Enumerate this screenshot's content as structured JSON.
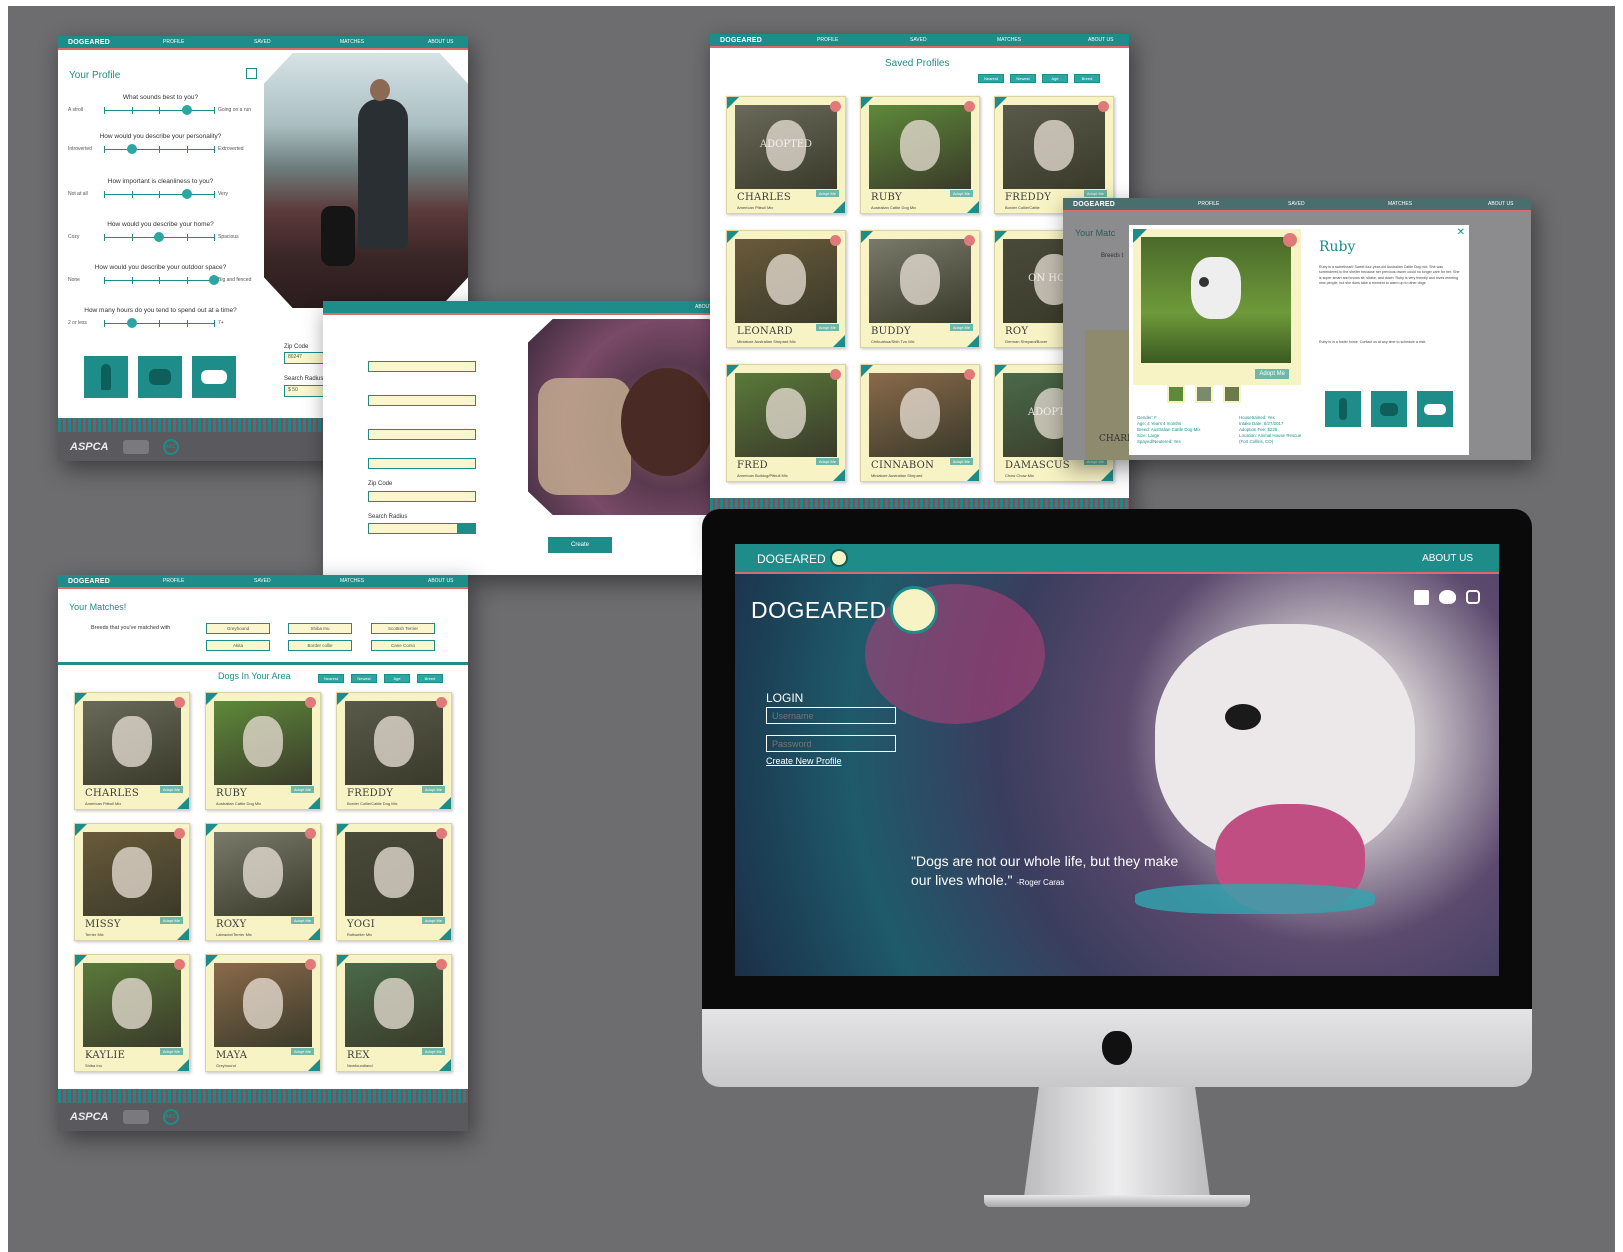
{
  "brand": "DOGEARED",
  "nav": {
    "profile": "PROFILE",
    "saved": "SAVED",
    "matches": "MATCHES",
    "about": "ABOUT US"
  },
  "footer": {
    "aspca": "ASPCA",
    "akc": "AKC"
  },
  "colors": {
    "teal": "#1e8c89",
    "card": "#f8f3c4",
    "accent": "#d96b6b",
    "field": "#fcf6cf"
  },
  "profile": {
    "title": "Your Profile",
    "questions": [
      {
        "q": "What sounds best to you?",
        "left": "A stroll",
        "right": "Going on a run",
        "value": 0.75
      },
      {
        "q": "How would you describe your personality?",
        "left": "Introverted",
        "right": "Extroverted",
        "value": 0.25
      },
      {
        "q": "How important is cleanliness to you?",
        "left": "Not at all",
        "right": "Very",
        "value": 0.75
      },
      {
        "q": "How would you describe your home?",
        "left": "Cozy",
        "right": "Spacious",
        "value": 0.5
      },
      {
        "q": "How would you describe your outdoor space?",
        "left": "None",
        "right": "Big and fenced",
        "value": 1.0
      },
      {
        "q": "How many hours do you tend to spend out at a time?",
        "left": "2 or less",
        "right": "7+",
        "value": 0.25
      }
    ],
    "zip_label": "Zip Code",
    "zip_value": "80247",
    "radius_label": "Search Radius",
    "radius_value": "$ 50"
  },
  "create": {
    "zip_label": "Zip Code",
    "radius_label": "Search Radius",
    "button": "Create"
  },
  "saved": {
    "title": "Saved Profiles",
    "filters": [
      "Nearest",
      "Newest",
      "Age",
      "Breed"
    ],
    "dogs": [
      {
        "name": "CHARLES",
        "breed": "American Pitbull Mix",
        "overlay": "ADOPTED"
      },
      {
        "name": "RUBY",
        "breed": "Australian Cattle Dog Mix",
        "overlay": ""
      },
      {
        "name": "FREDDY",
        "breed": "Border Collie/Cattle",
        "overlay": ""
      },
      {
        "name": "LEONARD",
        "breed": "Miniature Australian Shepard Mix",
        "overlay": ""
      },
      {
        "name": "BUDDY",
        "breed": "Chihuahua/Shih Tzu Mix",
        "overlay": ""
      },
      {
        "name": "ROY",
        "breed": "German Shepard/Boxer",
        "overlay": "ON HOLD"
      },
      {
        "name": "FRED",
        "breed": "American Bulldog/Pitbull Mix",
        "overlay": ""
      },
      {
        "name": "CINNABON",
        "breed": "Miniature Australian Shepard",
        "overlay": ""
      },
      {
        "name": "DAMASCUS",
        "breed": "Chow Chow Mix",
        "overlay": "ADOPTED"
      }
    ],
    "adopt_label": "Adopt Me"
  },
  "detail": {
    "bg_title": "Your Matc",
    "bg_breeds": "Breeds t",
    "bg_card_name": "CHARLE",
    "name": "Ruby",
    "close": "✕",
    "adopt": "Adopt Me",
    "bio1": "Ruby is a sweetheart! Sweet four-year-old Australian Cattle Dog mix. She was surrendered to the shelter because her previous owner could no longer care for her. She is super smart and knows sit, shake, and down. Ruby is very friendly and loves meeting new people, but she does take a moment to warm up to other dogs.",
    "bio2": "Ruby is in a foster home. Contact us at any time to schedule a visit.",
    "facts": [
      "Gender: F",
      "Age: 4 Years 4 months",
      "Breed: Australian Cattle Dog Mix",
      "Size: Large",
      "Spayed/Neutered: Yes"
    ],
    "facts2": [
      "Housetrained: Yes",
      "Intake Date: 6/27/2017",
      "Adoption Fee: $225",
      "Location: Animal House Rescue",
      "(Fort Collins, CO)"
    ]
  },
  "matches": {
    "title": "Your Matches!",
    "breeds_label": "Breeds that you've matched with",
    "breeds": [
      "Greyhound",
      "Shiba Inu",
      "Scottish Terrier",
      "Akita",
      "Border collie",
      "Cane Corso"
    ],
    "area_title": "Dogs In Your Area",
    "filters": [
      "Nearest",
      "Newest",
      "Age",
      "Breed"
    ],
    "adopt_label": "Adopt Me",
    "dogs": [
      {
        "name": "CHARLES",
        "breed": "American Pitbull Mix"
      },
      {
        "name": "RUBY",
        "breed": "Australian Cattle Dog Mix"
      },
      {
        "name": "FREDDY",
        "breed": "Border Collie/Cattle Dog Mix"
      },
      {
        "name": "MISSY",
        "breed": "Terrier Mix"
      },
      {
        "name": "ROXY",
        "breed": "Labrador/Terrier Mix"
      },
      {
        "name": "YOGI",
        "breed": "Rottweiler Mix"
      },
      {
        "name": "KAYLIE",
        "breed": "Shiba Inu"
      },
      {
        "name": "MAYA",
        "breed": "Greyhound"
      },
      {
        "name": "REX",
        "breed": "Newfoundland"
      }
    ]
  },
  "login": {
    "brand_small": "DOGEARED",
    "about": "ABOUT US",
    "brand_big": "DOGEARED",
    "login_title": "LOGIN",
    "username_placeholder": "Username",
    "password_placeholder": "Password",
    "create_link": "Create New Profile",
    "quote": "\"Dogs are not our whole life, but they make our lives whole.\"",
    "quote_author": "-Roger Caras"
  }
}
